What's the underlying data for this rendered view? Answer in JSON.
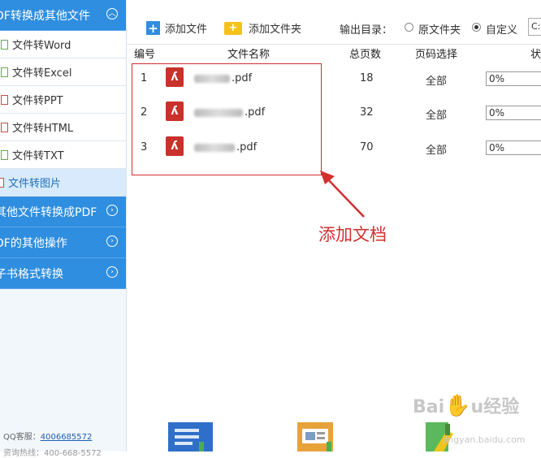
{
  "sidebar": {
    "section1": {
      "label": "DF转换成其他文件"
    },
    "items": [
      {
        "label": "文件转Word"
      },
      {
        "label": "文件转Excel"
      },
      {
        "label": "文件转PPT"
      },
      {
        "label": "文件转HTML"
      },
      {
        "label": "文件转TXT"
      },
      {
        "label": "文件转图片"
      }
    ],
    "section2": {
      "label": "其他文件转换成PDF"
    },
    "section3": {
      "label": "DF的其他操作"
    },
    "section4": {
      "label": "子书格式转换"
    },
    "qq_label": "QQ客服：",
    "qq_number": "4006685572",
    "phone_partial": "资询热线：400-668-5572"
  },
  "toolbar": {
    "add_file": "添加文件",
    "add_folder": "添加文件夹",
    "output_label": "输出目录：",
    "radio_original": "原文件夹",
    "radio_custom": "自定义",
    "path_value": "C:"
  },
  "table": {
    "headers": {
      "num": "编号",
      "name": "文件名称",
      "pages": "总页数",
      "range": "页码选择",
      "status": "状"
    },
    "rows": [
      {
        "num": "1",
        "name": ".pdf",
        "pages": "18",
        "range": "全部",
        "progress": "0%"
      },
      {
        "num": "2",
        "name": ".pdf",
        "pages": "32",
        "range": "全部",
        "progress": "0%"
      },
      {
        "num": "3",
        "name": ".pdf",
        "pages": "70",
        "range": "全部",
        "progress": "0%"
      }
    ]
  },
  "annotation": "添加文档",
  "watermark": {
    "text": "Baidu经验",
    "url": "jingyan.baidu.com"
  },
  "colors": {
    "accent": "#2f8ee0",
    "highlight": "#d32f2f"
  }
}
